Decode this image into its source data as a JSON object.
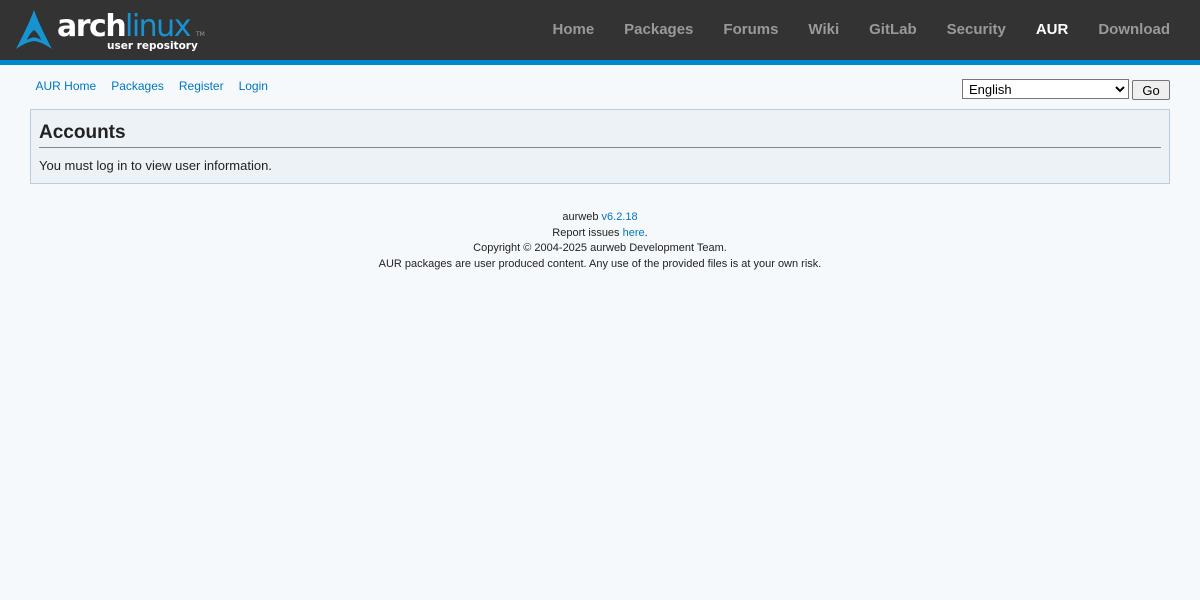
{
  "logo": {
    "word_arch": "arch",
    "word_linux": "linux",
    "tagline": "user repository",
    "tm": "TM"
  },
  "topnav": [
    {
      "label": "Home",
      "selected": false
    },
    {
      "label": "Packages",
      "selected": false
    },
    {
      "label": "Forums",
      "selected": false
    },
    {
      "label": "Wiki",
      "selected": false
    },
    {
      "label": "GitLab",
      "selected": false
    },
    {
      "label": "Security",
      "selected": false
    },
    {
      "label": "AUR",
      "selected": true
    },
    {
      "label": "Download",
      "selected": false
    }
  ],
  "subnav": [
    "AUR Home",
    "Packages",
    "Register",
    "Login"
  ],
  "language": {
    "selected": "English",
    "go_label": "Go"
  },
  "box": {
    "title": "Accounts",
    "message": "You must log in to view user information."
  },
  "footer": {
    "version_prefix": "aurweb ",
    "version": "v6.2.18",
    "report_prefix": "Report issues ",
    "report_link": "here",
    "report_suffix": ".",
    "copyright": "Copyright © 2004-2025 aurweb Development Team.",
    "disclaimer": "AUR packages are user produced content. Any use of the provided files is at your own risk."
  },
  "colors": {
    "navbar_bg": "#333333",
    "accent": "#0088cc",
    "link": "#0077bb",
    "page_bg": "#f6f9fc"
  }
}
